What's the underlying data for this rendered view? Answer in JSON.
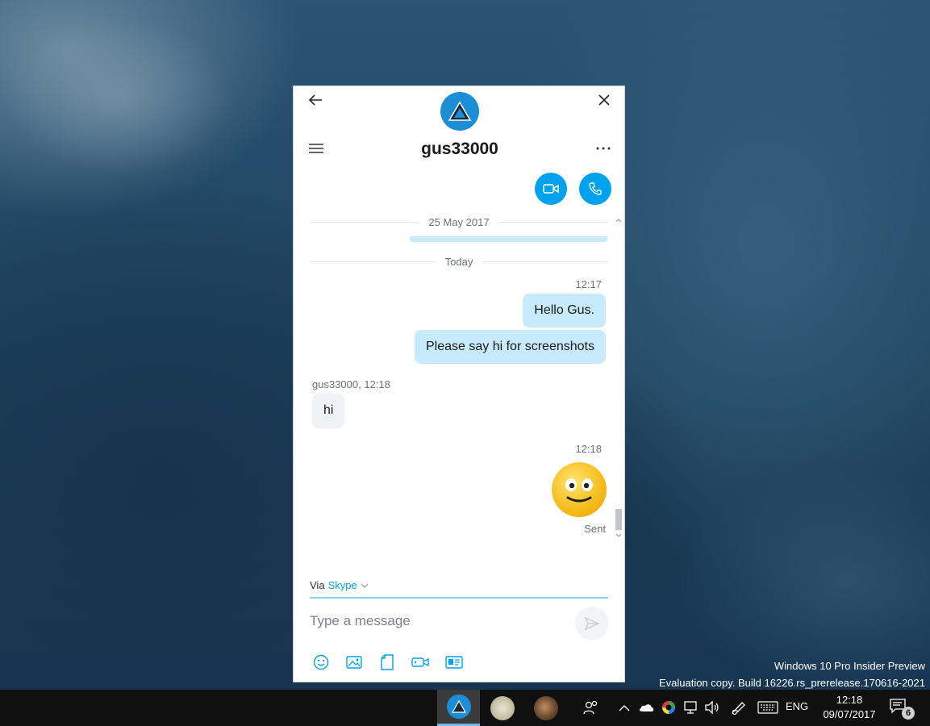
{
  "chat": {
    "contact_name": "gus33000",
    "date_separator_1": "25 May 2017",
    "date_separator_2": "Today",
    "outgoing_time_1": "12:17",
    "messages_out_1": [
      "Hello Gus.",
      "Please say hi for screenshots"
    ],
    "incoming_meta": "gus33000, 12:18",
    "incoming_text": "hi",
    "outgoing_time_2": "12:18",
    "outgoing_emoji": "smile",
    "sent_status": "Sent"
  },
  "composer": {
    "via_label": "Via",
    "via_service": "Skype",
    "placeholder": "Type a message"
  },
  "watermark": {
    "line1": "Windows 10 Pro Insider Preview",
    "line2": "Evaluation copy. Build 16226.rs_prerelease.170616-2021"
  },
  "taskbar": {
    "language": "ENG",
    "time": "12:18",
    "date": "09/07/2017",
    "notification_count": "6"
  },
  "colors": {
    "skype_blue": "#00a2ed",
    "bubble_out": "#c7ebfc",
    "bubble_in": "#f0f2f5"
  }
}
